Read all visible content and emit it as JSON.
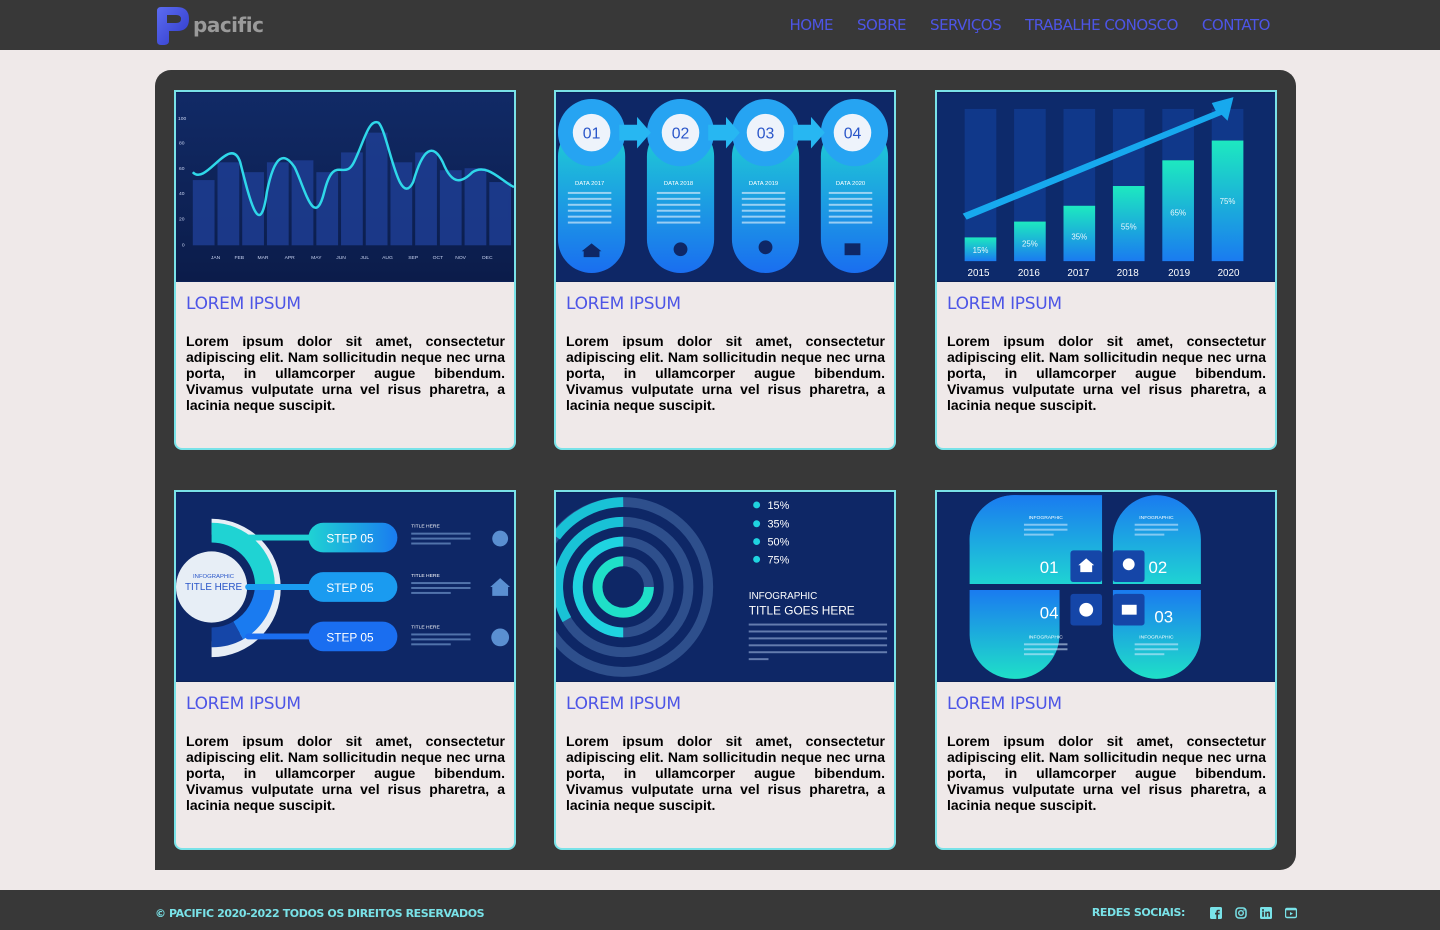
{
  "header": {
    "logo_text": "pacific",
    "nav": [
      "HOME",
      "SOBRE",
      "SERVIÇOS",
      "TRABALHE CONOSCO",
      "CONTATO"
    ]
  },
  "cards": [
    {
      "title": "LOREM IPSUM",
      "text": "Lorem ipsum dolor sit amet, consectetur adipiscing elit. Nam sollicitudin neque nec urna porta, in ullamcorper augue bibendum. Vivamus vulputate urna vel risus pharetra, a lacinia neque suscipit.",
      "image": {
        "y_ticks": [
          "100",
          "80",
          "60",
          "40",
          "20",
          "0"
        ],
        "months": [
          "JAN",
          "FEB",
          "MAR",
          "APR",
          "MAY",
          "JUN",
          "JUL",
          "AUG",
          "SEP",
          "OCT",
          "NOV",
          "DEC"
        ]
      }
    },
    {
      "title": "LOREM IPSUM",
      "text": "Lorem ipsum dolor sit amet, consectetur adipiscing elit. Nam sollicitudin neque nec urna porta, in ullamcorper augue bibendum. Vivamus vulputate urna vel risus pharetra, a lacinia neque suscipit.",
      "image": {
        "steps": [
          "01",
          "02",
          "03",
          "04"
        ],
        "dates": [
          "DATA 2017",
          "DATA 2018",
          "DATA 2019",
          "DATA 2020"
        ]
      }
    },
    {
      "title": "LOREM IPSUM",
      "text": "Lorem ipsum dolor sit amet, consectetur adipiscing elit. Nam sollicitudin neque nec urna porta, in ullamcorper augue bibendum. Vivamus vulputate urna vel risus pharetra, a lacinia neque suscipit.",
      "image": {
        "years": [
          "2015",
          "2016",
          "2017",
          "2018",
          "2019",
          "2020"
        ],
        "percents": [
          "15%",
          "25%",
          "35%",
          "55%",
          "65%",
          "75%"
        ]
      }
    },
    {
      "title": "LOREM IPSUM",
      "text": "Lorem ipsum dolor sit amet, consectetur adipiscing elit. Nam sollicitudin neque nec urna porta, in ullamcorper augue bibendum. Vivamus vulputate urna vel risus pharetra, a lacinia neque suscipit.",
      "image": {
        "center_small": "INFOGRAPHIC",
        "center_title": "TITLE HERE",
        "steps": [
          "STEP 05",
          "STEP 05",
          "STEP 05"
        ],
        "item_title": "TITLE HERE"
      }
    },
    {
      "title": "LOREM IPSUM",
      "text": "Lorem ipsum dolor sit amet, consectetur adipiscing elit. Nam sollicitudin neque nec urna porta, in ullamcorper augue bibendum. Vivamus vulputate urna vel risus pharetra, a lacinia neque suscipit.",
      "image": {
        "legend": [
          "15%",
          "35%",
          "50%",
          "75%"
        ],
        "small": "INFOGRAPHIC",
        "title": "TITLE GOES HERE"
      }
    },
    {
      "title": "LOREM IPSUM",
      "text": "Lorem ipsum dolor sit amet, consectetur adipiscing elit. Nam sollicitudin neque nec urna porta, in ullamcorper augue bibendum. Vivamus vulputate urna vel risus pharetra, a lacinia neque suscipit.",
      "image": {
        "numbers": [
          "01",
          "02",
          "04",
          "03"
        ],
        "label": "INFOGRAPHIC"
      }
    }
  ],
  "footer": {
    "copyright": "© PACIFIC 2020-2022 TODOS OS DIREITOS RESERVADOS",
    "social_label": "REDES SOCIAIS:",
    "social_icons": [
      "facebook-icon",
      "instagram-icon",
      "linkedin-icon",
      "youtube-icon"
    ]
  },
  "colors": {
    "accent": "#4d55e6",
    "cyan": "#79e2e8",
    "dark": "#383838",
    "background": "#efe9e9"
  }
}
